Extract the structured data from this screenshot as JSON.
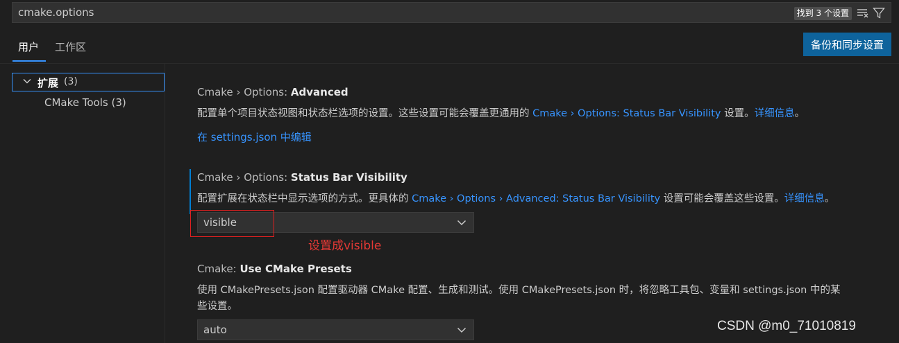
{
  "search": {
    "value": "cmake.options",
    "result_count": "找到 3 个设置",
    "clear_filter_icon": "clear-filter-icon",
    "filter_icon": "filter-icon"
  },
  "tabs": [
    {
      "label": "用户",
      "active": true
    },
    {
      "label": "工作区",
      "active": false
    }
  ],
  "sync_button_label": "备份和同步设置",
  "toc": {
    "extensions_label": "扩展",
    "extensions_count": "(3)",
    "cmake_tools": "CMake Tools (3)"
  },
  "settings": [
    {
      "category": "Cmake › Options: ",
      "name": "Advanced",
      "desc_prefix": "配置单个项目状态视图和状态栏选项的设置。这些设置可能会覆盖更通用的 ",
      "desc_link": "Cmake › Options: Status Bar Visibility",
      "desc_suffix": " 设置。",
      "more_info": "详细信息",
      "desc_end": "。",
      "edit_link": "在 settings.json 中编辑"
    },
    {
      "category": "Cmake › Options: ",
      "name": "Status Bar Visibility",
      "desc_prefix": "配置扩展在状态栏中显示选项的方式。更具体的 ",
      "desc_link": "Cmake › Options › Advanced: Status Bar Visibility",
      "desc_suffix": " 设置可能会覆盖这些设置。",
      "more_info": "详细信息",
      "desc_end": "。",
      "value": "visible"
    },
    {
      "category": "Cmake: ",
      "name": "Use CMake Presets",
      "desc_line1": "使用 CMakePresets.json 配置驱动器 CMake 配置、生成和测试。使用 CMakePresets.json 时，将忽略工具包、变量和 settings.json 中的某",
      "desc_line2": "些设置。",
      "value": "auto"
    }
  ],
  "annotation": "设置成visible",
  "watermark": "CSDN @m0_71010819",
  "colors": {
    "accent": "#3794ff",
    "button": "#0e639c",
    "annotation": "#e02020"
  }
}
